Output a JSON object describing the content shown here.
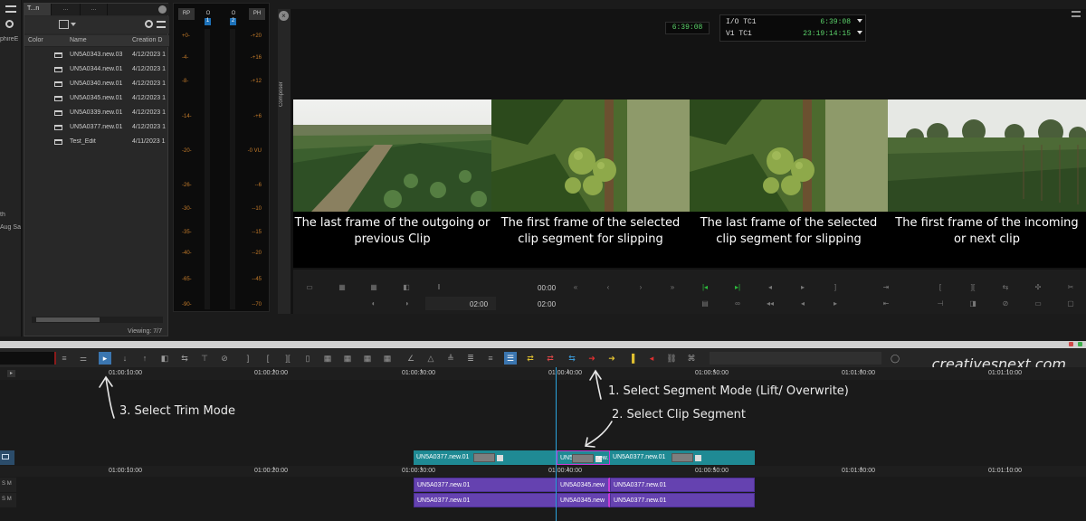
{
  "left_strip": {
    "items": [
      "phireE",
      "th",
      "Aug Sa"
    ]
  },
  "bin": {
    "tabs": [
      "T...n",
      "...",
      "..."
    ],
    "columns": [
      "Color",
      "Name",
      "Creation D"
    ],
    "rows": [
      {
        "name": "UN5A0343.new.03",
        "date": "4/12/2023 1"
      },
      {
        "name": "UN5A0344.new.01",
        "date": "4/12/2023 1"
      },
      {
        "name": "UN5A0340.new.01",
        "date": "4/12/2023 1"
      },
      {
        "name": "UN5A0345.new.01",
        "date": "4/12/2023 1"
      },
      {
        "name": "UN5A0339.new.01",
        "date": "4/12/2023 1"
      },
      {
        "name": "UN5A0377.new.01",
        "date": "4/12/2023 1"
      },
      {
        "name": "Test_Edit",
        "date": "4/11/2023 1"
      }
    ],
    "viewing": "Viewing: 7/7"
  },
  "meters": {
    "heads": [
      "RP",
      "O",
      "O",
      "PH"
    ],
    "channels": [
      "1",
      "2"
    ],
    "left_scale": [
      "+0-",
      "-4-",
      "-8-",
      "-14-",
      "-20-",
      "-26-",
      "-30-",
      "-35-",
      "-40-",
      "-65-",
      "-90-"
    ],
    "right_scale": [
      "-+20",
      "-+16",
      "-+12",
      "-+6",
      "-0 VU",
      "--6",
      "--10",
      "--15",
      "--20",
      "--45",
      "--70"
    ]
  },
  "composer": {
    "close": "×",
    "label": "Composer",
    "tc_main": "6:39:08",
    "tc_rows": [
      {
        "label": "I/O  TC1",
        "value": "6:39:08"
      },
      {
        "label": "V1  TC1",
        "value": "23:19:14:15"
      }
    ],
    "captions": [
      "The last frame of the outgoing or previous Clip",
      "The first frame of the selected clip segment for slipping",
      "The last frame of the selected clip segment for slipping",
      "The first frame of the incoming or next clip"
    ],
    "marker_left": "0",
    "marker_right": "0",
    "tc_a": "00:00",
    "tc_b": "00:00",
    "tc_c": "02:00",
    "tc_d": "02:00"
  },
  "toolbar_icons": [
    "trim-mode-icon",
    "lift-icon",
    "overwrite-icon"
  ],
  "timeline": {
    "ruler_top": [
      "01:00:10:00",
      "01:00:20:00",
      "01:00:30:00",
      "01:00:40:00",
      "01:00:50:00",
      "01:01:00:00",
      "01:01:10:00"
    ],
    "ruler_bottom": [
      "01:00:10:00",
      "01:00:20:00",
      "01:00:30:00",
      "01:00:40:00",
      "01:00:50:00",
      "01:01:00:00",
      "01:01:10:00"
    ],
    "v1_clips": [
      "UN5A0377.new.01",
      "UN5",
      "new.",
      "UN5A0377.new.01"
    ],
    "a1_clips": [
      "UN5A0377.new.01",
      "UN5A0345.new",
      "UN5A0377.new.01"
    ],
    "a2_clips": [
      "UN5A0377.new.01",
      "UN5A0345.new",
      "UN5A0377.new.01"
    ],
    "track_labels": [
      "S",
      "M",
      "S",
      "M"
    ]
  },
  "annotations": {
    "step1": "1. Select Segment Mode (Lift/ Overwrite)",
    "step2": "2. Select Clip Segment",
    "step3": "3. Select Trim Mode"
  },
  "watermark": "creativesnext.com",
  "colors": {
    "accent_blue": "#3b76b0",
    "teal_clip": "#1f8a94",
    "purple_clip": "#6542b0",
    "timecode_green": "#5bd36a",
    "meter_orange": "#c47b2a",
    "playhead": "#2aa3dd"
  }
}
